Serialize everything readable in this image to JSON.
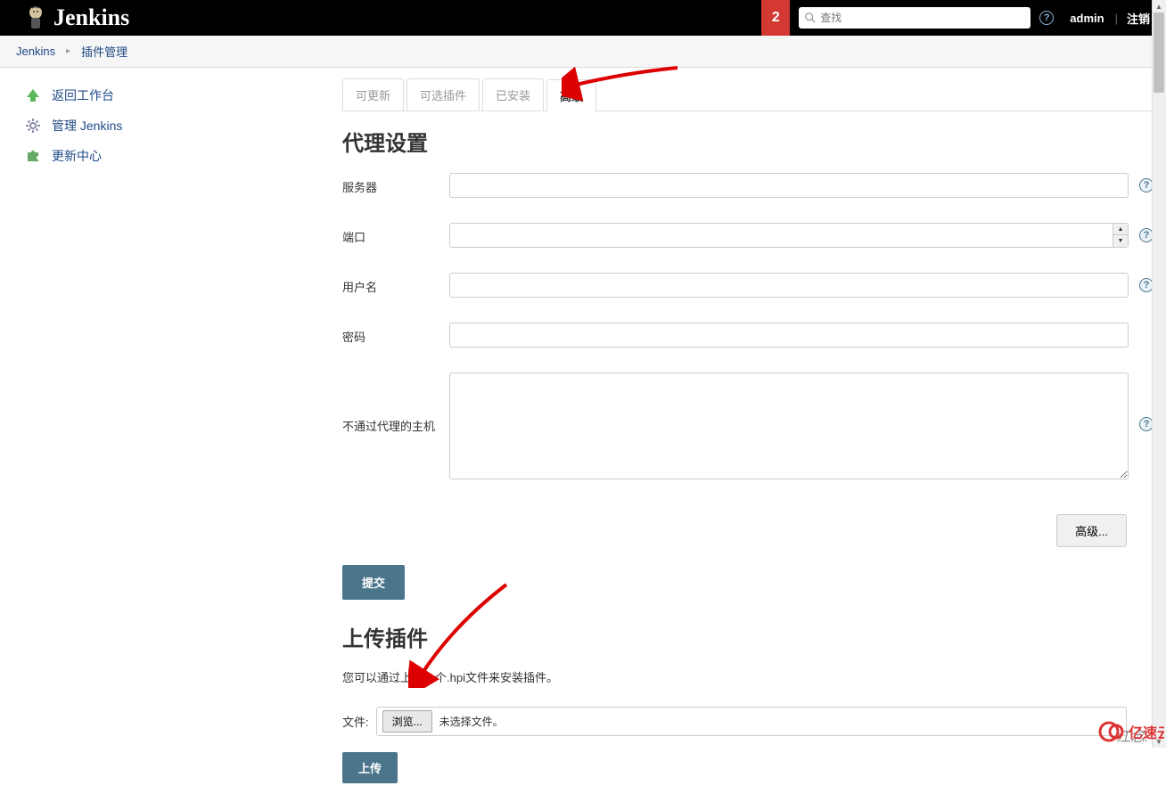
{
  "header": {
    "logo_text": "Jenkins",
    "notification_count": "2",
    "search_placeholder": "查找",
    "user": "admin",
    "logout": "注销"
  },
  "breadcrumb": {
    "items": [
      "Jenkins",
      "插件管理"
    ]
  },
  "sidebar": {
    "items": [
      {
        "label": "返回工作台"
      },
      {
        "label": "管理 Jenkins"
      },
      {
        "label": "更新中心"
      }
    ]
  },
  "tabs": {
    "updatable": "可更新",
    "available": "可选插件",
    "installed": "已安装",
    "advanced": "高级"
  },
  "proxy_section": {
    "title": "代理设置",
    "server_label": "服务器",
    "port_label": "端口",
    "username_label": "用户名",
    "password_label": "密码",
    "noproxy_label": "不通过代理的主机",
    "advanced_btn": "高级...",
    "submit_btn": "提交"
  },
  "upload_section": {
    "title": "上传插件",
    "description": "您可以通过上传一个.hpi文件来安装插件。",
    "file_label": "文件:",
    "browse_btn": "浏览...",
    "no_file": "未选择文件。",
    "upload_btn": "上传"
  },
  "watermark": "江念.",
  "watermark_brand": "亿速云"
}
